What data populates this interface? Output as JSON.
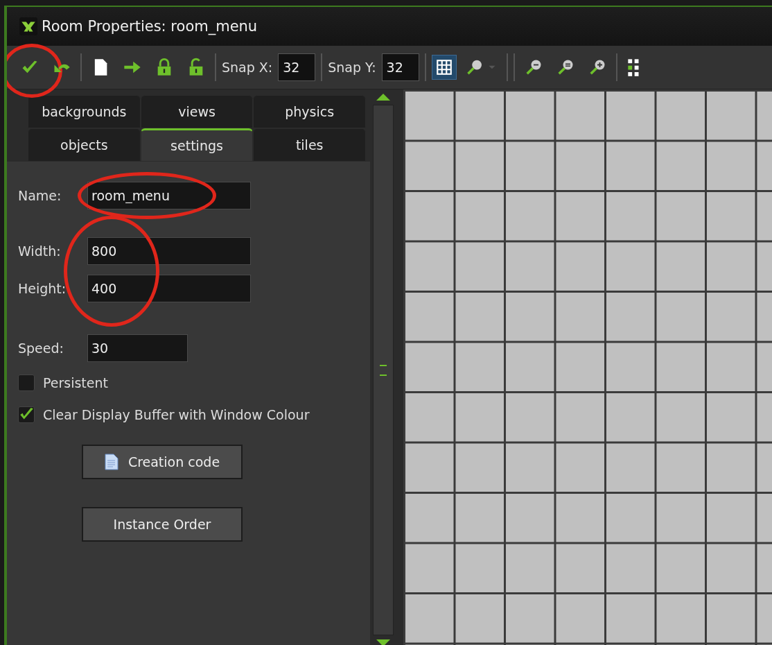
{
  "window": {
    "title": "Room Properties: room_menu"
  },
  "toolbar": [
    {
      "kind": "check",
      "circled": true
    },
    {
      "kind": "undo",
      "circled": false
    },
    {
      "kind": "separator"
    },
    {
      "kind": "page",
      "circled": false
    },
    {
      "kind": "arrow",
      "circled": false
    },
    {
      "kind": "lock",
      "circled": false
    },
    {
      "kind": "unlock",
      "circled": false
    },
    {
      "kind": "separator"
    },
    {
      "kind": "snap",
      "label": "Snap X:",
      "value": "32"
    },
    {
      "kind": "separator"
    },
    {
      "kind": "snap",
      "label": "Snap Y:",
      "value": "32"
    },
    {
      "kind": "separator"
    },
    {
      "kind": "grid",
      "on": true
    },
    {
      "kind": "zoom-menu",
      "circled": false
    },
    {
      "kind": "separator"
    },
    {
      "kind": "separator"
    },
    {
      "kind": "zoom-out",
      "circled": false
    },
    {
      "kind": "zoom-reset",
      "circled": false
    },
    {
      "kind": "zoom-in",
      "circled": false
    },
    {
      "kind": "separator"
    },
    {
      "kind": "select",
      "circled": false
    }
  ],
  "tabs": [
    [
      {
        "label": "backgrounds",
        "selected": false
      },
      {
        "label": "views",
        "selected": false
      },
      {
        "label": "physics",
        "selected": false
      }
    ],
    [
      {
        "label": "objects",
        "selected": false
      },
      {
        "label": "settings",
        "selected": true
      },
      {
        "label": "tiles",
        "selected": false
      }
    ]
  ],
  "settings": {
    "name": {
      "label": "Name:",
      "value": "room_menu",
      "circled": true
    },
    "size_circled": true,
    "width": {
      "label": "Width:",
      "value": "800"
    },
    "height": {
      "label": "Height:",
      "value": "400"
    },
    "speed": {
      "label": "Speed:",
      "value": "30"
    },
    "checkboxes": [
      {
        "label": "Persistent",
        "checked": false
      },
      {
        "label": "Clear Display Buffer with Window Colour",
        "checked": true
      }
    ],
    "buttons": [
      {
        "label": "Creation code",
        "kind": "code"
      },
      {
        "label": "Instance Order",
        "kind": "plain"
      }
    ]
  }
}
